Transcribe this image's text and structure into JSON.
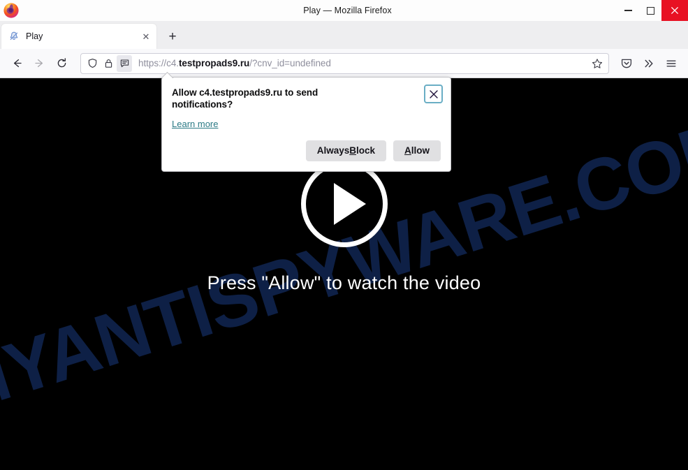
{
  "window": {
    "title": "Play — Mozilla Firefox",
    "app_icon": "firefox-logo-icon",
    "controls": {
      "minimize": "—",
      "maximize": "□",
      "close": "✕"
    }
  },
  "tabs": {
    "items": [
      {
        "title": "Play",
        "favicon": "bell-notification-favicon",
        "close_label": "✕"
      }
    ],
    "new_tab_label": "+"
  },
  "navigation": {
    "back": "back-arrow-icon",
    "forward": "forward-arrow-icon",
    "reload": "reload-icon"
  },
  "urlbar": {
    "shield_icon": "tracking-protection-shield-icon",
    "lock_icon": "padlock-icon",
    "permission_icon": "notification-bubble-icon",
    "url_prefix": "https://c4.",
    "url_host": "testpropads9.ru",
    "url_suffix": "/?cnv_id=undefined",
    "full_url": "https://c4.testpropads9.ru/?cnv_id=undefined",
    "bookmark_icon": "star-outline-icon"
  },
  "toolbar_right": {
    "pocket": "pocket-save-icon",
    "overflow": "»",
    "menu": "hamburger-menu-icon"
  },
  "notification_popup": {
    "title": "Allow c4.testpropads9.ru to send notifications?",
    "learn_more": "Learn more",
    "close_label": "✕",
    "buttons": [
      {
        "name": "always-block",
        "prefix": "Always ",
        "accesskey": "B",
        "suffix": "lock"
      },
      {
        "name": "allow",
        "prefix": "",
        "accesskey": "A",
        "suffix": "llow"
      }
    ]
  },
  "page": {
    "watermark": "MYANTISPYWARE.COM",
    "play_button": "play-triangle-icon",
    "prompt_text": "Press \"Allow\" to watch the video",
    "background_color": "#000000"
  },
  "colors": {
    "close_button_red": "#e81123",
    "link_teal": "#2b7a85",
    "watermark_blue": "#0e2046",
    "focus_ring": "#6aaec5"
  }
}
